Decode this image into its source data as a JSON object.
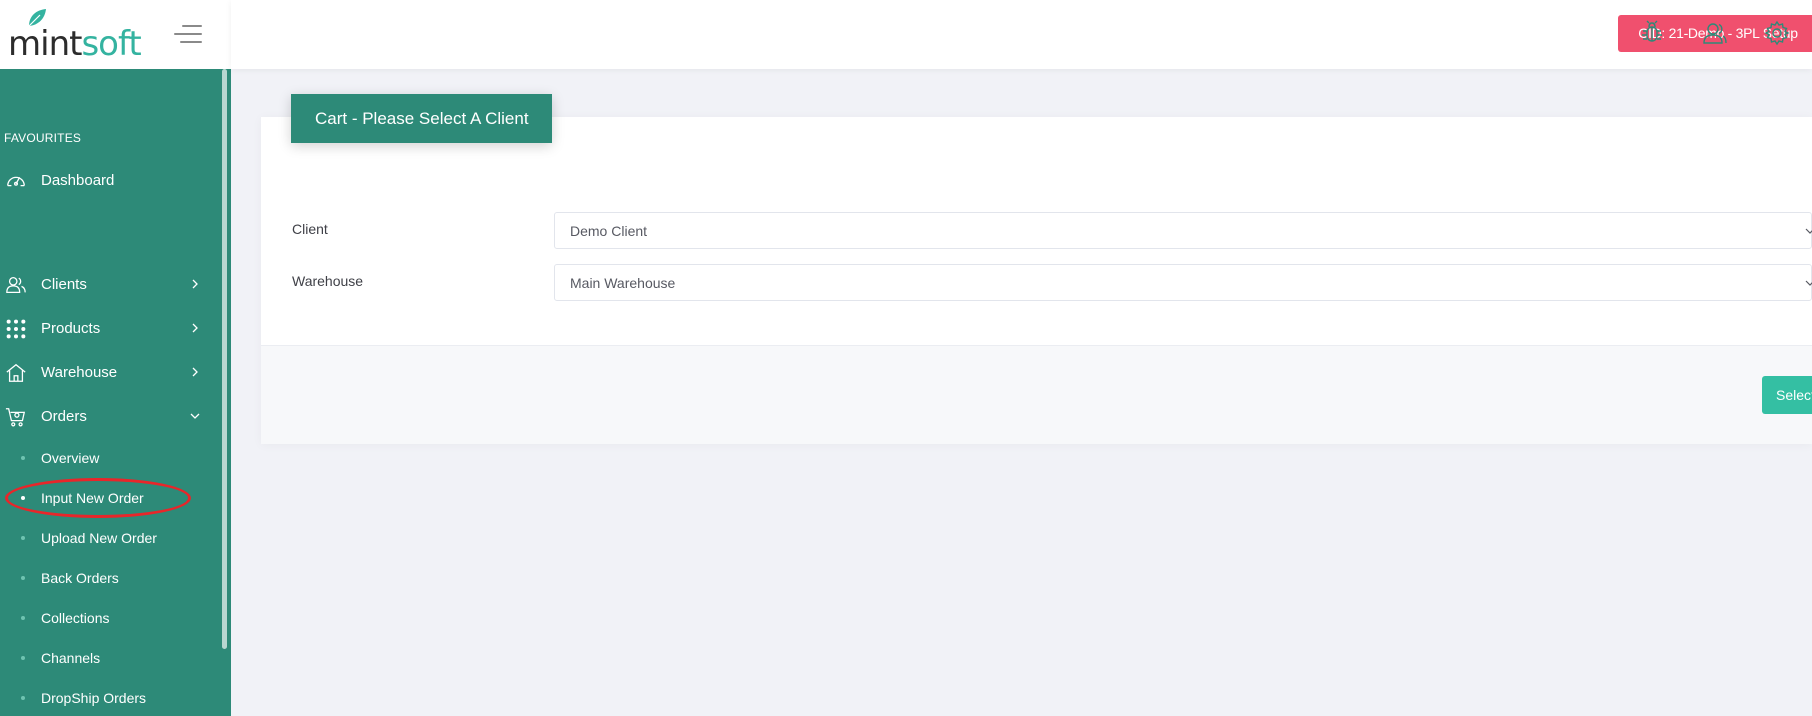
{
  "brand": {
    "logo_part1": "mint",
    "logo_part2": "soft"
  },
  "topbar": {
    "cid_badge": "CID: 21-Demo - 3PL Setup"
  },
  "sidebar": {
    "section_favourites": "FAVOURITES",
    "dashboard": "Dashboard",
    "items": [
      {
        "label": "Clients"
      },
      {
        "label": "Products"
      },
      {
        "label": "Warehouse"
      },
      {
        "label": "Orders"
      }
    ],
    "orders_sub": [
      {
        "label": "Overview"
      },
      {
        "label": "Input New Order"
      },
      {
        "label": "Upload New Order"
      },
      {
        "label": "Back Orders"
      },
      {
        "label": "Collections"
      },
      {
        "label": "Channels"
      },
      {
        "label": "DropShip Orders"
      }
    ]
  },
  "main": {
    "card_title": "Cart - Please Select A Client",
    "client_label": "Client",
    "client_value": "Demo Client",
    "warehouse_label": "Warehouse",
    "warehouse_value": "Main Warehouse",
    "select_button": "Select"
  },
  "colors": {
    "sidebar_bg": "#2d8a78",
    "accent": "#34bfa3",
    "badge": "#f0506e",
    "highlight": "#e8262a"
  }
}
